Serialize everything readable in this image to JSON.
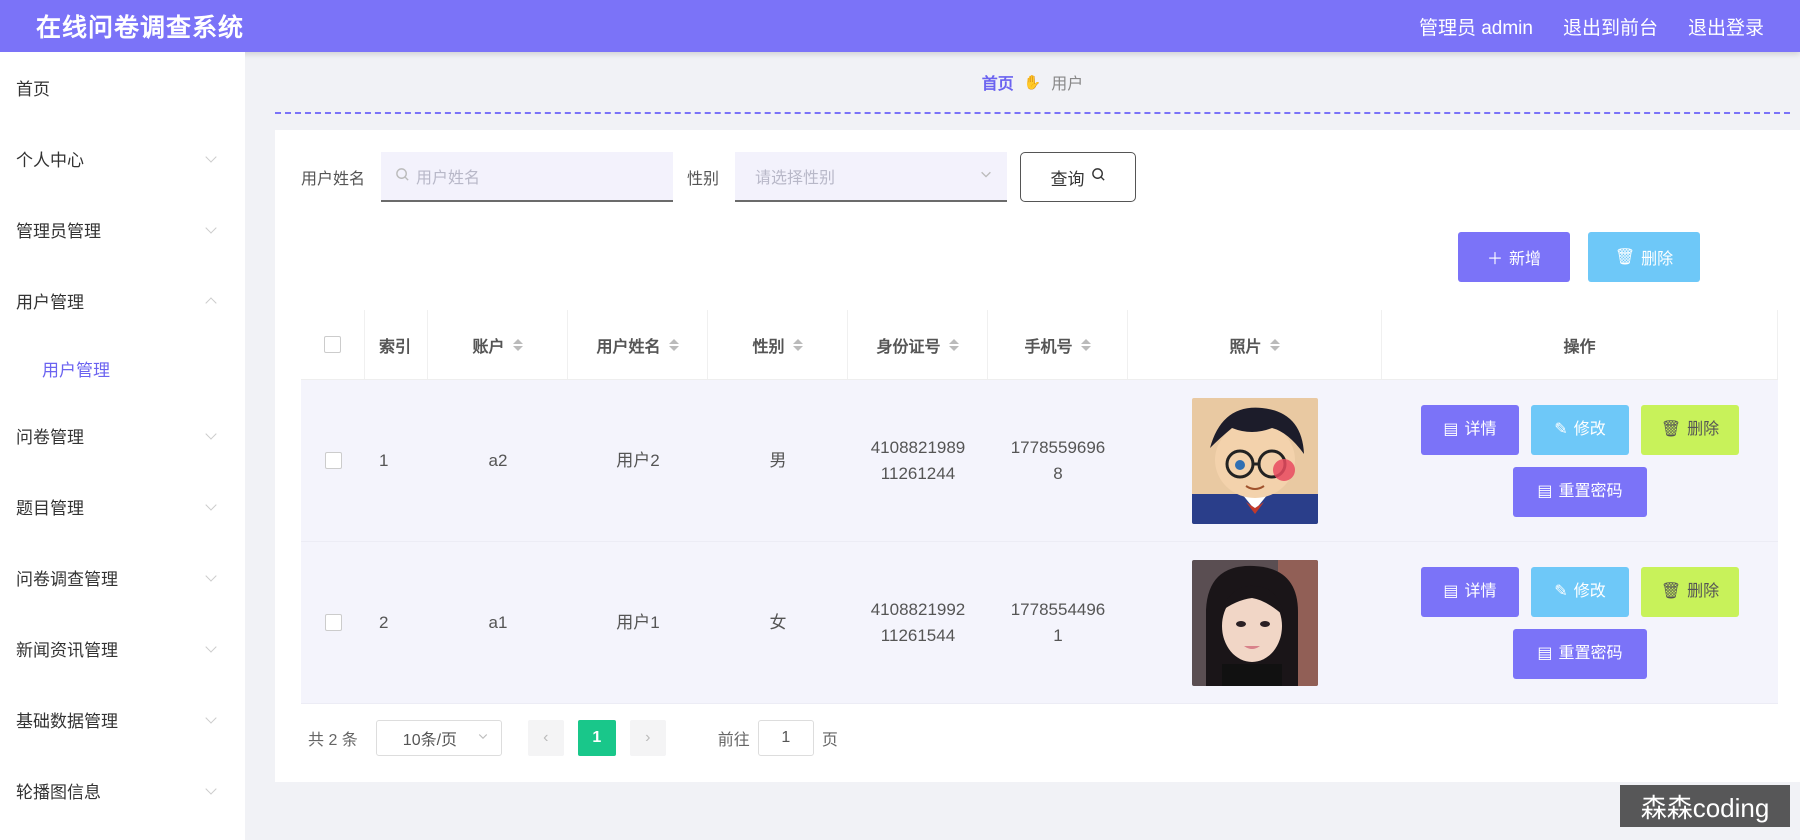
{
  "header": {
    "app_title": "在线问卷调查系统",
    "admin_label": "管理员 admin",
    "to_frontend": "退出到前台",
    "logout": "退出登录"
  },
  "sidebar": {
    "items": [
      {
        "label": "首页"
      },
      {
        "label": "个人中心"
      },
      {
        "label": "管理员管理"
      },
      {
        "label": "用户管理"
      },
      {
        "label": "用户管理"
      },
      {
        "label": "问卷管理"
      },
      {
        "label": "题目管理"
      },
      {
        "label": "问卷调查管理"
      },
      {
        "label": "新闻资讯管理"
      },
      {
        "label": "基础数据管理"
      },
      {
        "label": "轮播图信息"
      }
    ]
  },
  "breadcrumb": {
    "home": "首页",
    "current": "用户"
  },
  "search": {
    "name_label": "用户姓名",
    "name_placeholder": "用户姓名",
    "sex_label": "性别",
    "sex_placeholder": "请选择性别",
    "query_button": "查询"
  },
  "actions": {
    "add": "新增",
    "delete": "删除"
  },
  "table": {
    "headers": [
      "索引",
      "账户",
      "用户姓名",
      "性别",
      "身份证号",
      "手机号",
      "照片",
      "操作"
    ],
    "rows": [
      {
        "index": "1",
        "account": "a2",
        "name": "用户2",
        "sex": "男",
        "id_line1": "4108821989",
        "id_line2": "11261244",
        "phone_line1": "1778559696",
        "phone_line2": "8"
      },
      {
        "index": "2",
        "account": "a1",
        "name": "用户1",
        "sex": "女",
        "id_line1": "4108821992",
        "id_line2": "11261544",
        "phone_line1": "1778554496",
        "phone_line2": "1"
      }
    ],
    "ops": {
      "detail": "详情",
      "edit": "修改",
      "remove": "删除",
      "reset": "重置密码"
    }
  },
  "pagination": {
    "total_text": "共 2 条",
    "page_size": "10条/页",
    "current_page": "1",
    "goto_label": "前往",
    "goto_value": "1",
    "page_suffix": "页"
  },
  "watermark": "森森coding"
}
